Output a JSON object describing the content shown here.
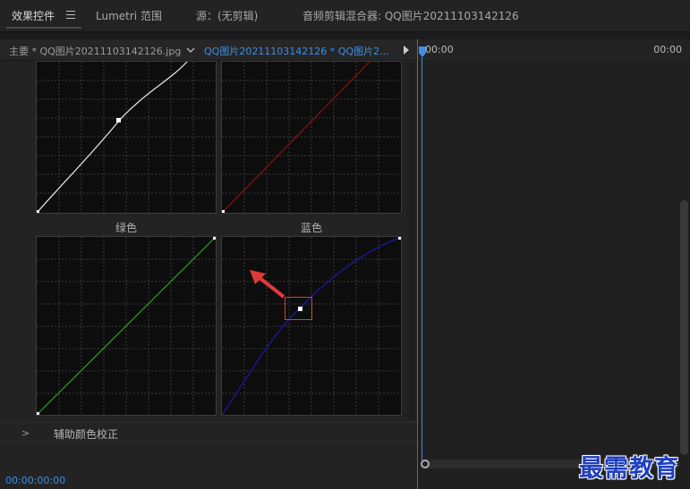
{
  "tabs": [
    {
      "label": "效果控件",
      "active": true
    },
    {
      "label": "Lumetri 范围",
      "active": false
    },
    {
      "label": "源：(无剪辑)",
      "active": false
    },
    {
      "label": "音频剪辑混合器: QQ图片20211103142126",
      "active": false
    }
  ],
  "clipbar": {
    "master_label": "主要 * QQ图片20211103142126.jpg",
    "clip_label": "QQ图片20211103142126 * QQ图片2..."
  },
  "curves": {
    "green_label": "绿色",
    "blue_label": "蓝色"
  },
  "secondary_section": {
    "label": "辅助颜色校正"
  },
  "status": {
    "timecode": "00:00:00:00"
  },
  "timeline": {
    "start_time": "00:00",
    "end_time": "00:00"
  },
  "watermark": "最需教育",
  "colors": {
    "accent": "#3d8ee8",
    "highlight_box": "#e0393a",
    "red_curve": "#8b1010",
    "green_curve": "#22aa22",
    "blue_curve": "#1a1aa8"
  },
  "icons": [
    "menu-icon",
    "chevron-down-icon",
    "play-icon",
    "chevron-right-icon",
    "arrow-annotation-icon"
  ]
}
